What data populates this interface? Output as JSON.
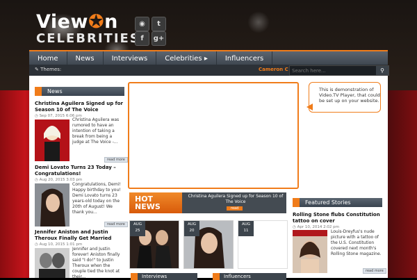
{
  "brand": {
    "line1a": "View",
    "line1b": "n",
    "line2": "CELEBRITIES"
  },
  "social": {
    "rss": "◉",
    "twitter": "t",
    "facebook": "f",
    "gplus": "g+"
  },
  "nav": {
    "items": [
      "Home",
      "News",
      "Interviews",
      "Celebrities ▸",
      "Influencers"
    ]
  },
  "subbar": {
    "themes_label": "Themes:",
    "ticker_text": "Cameron C"
  },
  "search": {
    "placeholder": "Search here..."
  },
  "news": {
    "heading": "News",
    "articles": [
      {
        "title": "Christina Aguilera Signed up for Season 10 of The Voice",
        "date": "Sep 07, 2015 6:06 pm",
        "excerpt": "Christina Aguilera was rumored to have an intention of taking a break from being a judge at The Voice -...",
        "read_more": "read more"
      },
      {
        "title": "Demi Lovato Turns 23 Today – Congratulations!",
        "date": "Aug 20, 2015 3:03 pm",
        "excerpt": "Congratulations, Demi! Happy birthday to you! Demi Lovato turns 23 years-old today on the 20th of August! We thank you...",
        "read_more": "read more"
      },
      {
        "title": "Jennifer Aniston and Justin Theroux Finally Get Married",
        "date": "Aug 10, 2015 1:01 pm",
        "excerpt": "Jennifer and Justin forever! Aniston finally said \"I do!\" to Justin Theroux when the couple tied the knot at their..."
      }
    ]
  },
  "player": {
    "callout": "This is demonstration of Video.TV Player, that could be set up on your website."
  },
  "hot_news": {
    "label_line1": "HOT",
    "label_line2": "NEWS",
    "headline": "Christina Aguilera Signed up for Season 10 of The Voice",
    "read": "read",
    "tiles": [
      {
        "month": "AUG",
        "day": "25"
      },
      {
        "month": "AUG",
        "day": "20"
      },
      {
        "month": "AUG",
        "day": "11"
      }
    ]
  },
  "featured": {
    "heading": "Featured Stories",
    "title": "Rolling Stone flubs Constitution tattoo on cover",
    "date": "Apr 10, 2014 2:02 pm",
    "excerpt": "Louis-Dreyfus's nude picture with a tattoo of the U.S. Constitution covered next month's Rolling Stone magazine.",
    "read_more": "read more"
  },
  "bottom_tabs": {
    "interviews": "Interviews",
    "influencers": "Influencers"
  },
  "colors": {
    "accent": "#f07c1a",
    "nav": "#4a525b",
    "carpet": "#c4141b"
  }
}
